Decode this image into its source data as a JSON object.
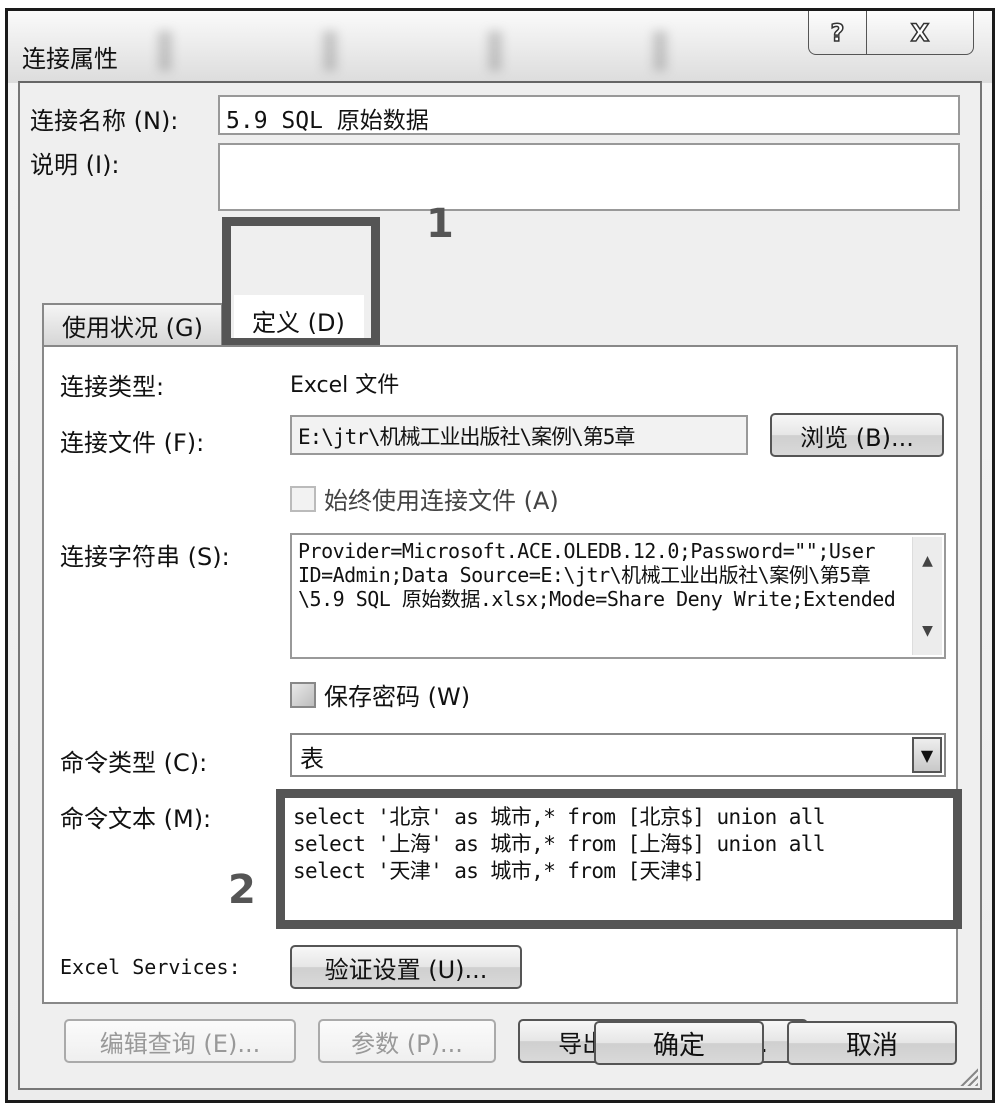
{
  "window": {
    "title": "连接属性",
    "help_icon": "?",
    "close_icon": "X"
  },
  "fields": {
    "connection_name_label": "连接名称 (N):",
    "connection_name_value": "5.9 SQL 原始数据",
    "description_label": "说明 (I):",
    "description_value": ""
  },
  "tabs": [
    {
      "label": "使用状况 (G)",
      "active": false
    },
    {
      "label": "定义 (D)",
      "active": true
    }
  ],
  "annotations": {
    "one": "1",
    "two": "2"
  },
  "definition": {
    "connection_type_label": "连接类型:",
    "connection_type_value": "Excel 文件",
    "connection_file_label": "连接文件 (F):",
    "connection_file_value": "E:\\jtr\\机械工业出版社\\案例\\第5章",
    "browse_button": "浏览 (B)...",
    "always_use_file_label": "始终使用连接文件 (A)",
    "always_use_file_checked": false,
    "connection_string_label": "连接字符串 (S):",
    "connection_string_value": "Provider=Microsoft.ACE.OLEDB.12.0;Password=\"\";User ID=Admin;Data Source=E:\\jtr\\机械工业出版社\\案例\\第5章\\5.9 SQL 原始数据.xlsx;Mode=Share Deny Write;Extended",
    "save_password_label": "保存密码 (W)",
    "save_password_checked": false,
    "command_type_label": "命令类型 (C):",
    "command_type_value": "表",
    "command_text_label": "命令文本 (M):",
    "command_text_value": "select '北京' as 城市,* from [北京$] union all\nselect '上海' as 城市,* from [上海$] union all\nselect '天津' as 城市,* from [天津$]",
    "excel_services_label": "Excel Services:",
    "auth_settings_button": "验证设置 (U)...",
    "edit_query_button": "编辑查询 (E)...",
    "parameters_button": "参数 (P)...",
    "export_connection_button": "导出连接文件 (X)..."
  },
  "footer": {
    "ok_button": "确定",
    "cancel_button": "取消"
  }
}
